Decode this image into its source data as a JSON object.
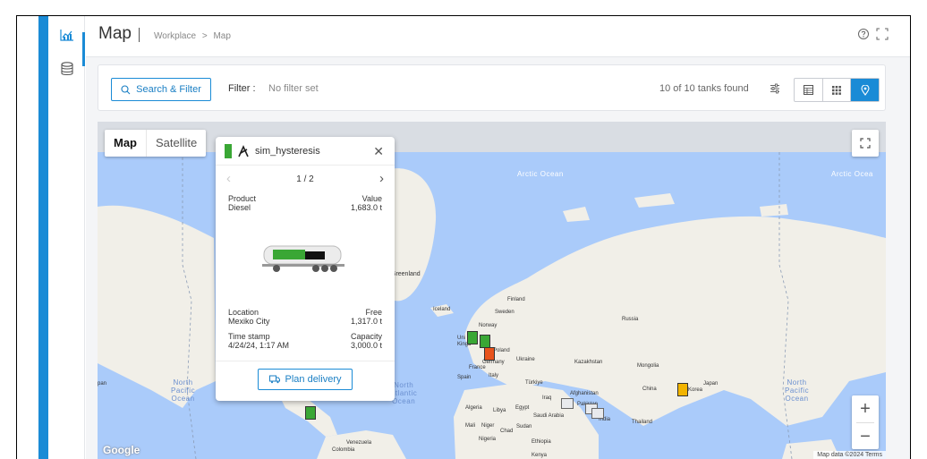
{
  "header": {
    "title": "Map",
    "breadcrumb": [
      "Workplace",
      ">",
      "Map"
    ]
  },
  "sidebar": {
    "items": [
      {
        "icon": "chart-icon",
        "active": true
      },
      {
        "icon": "database-icon",
        "active": false
      }
    ]
  },
  "toolbar": {
    "search_label": "Search & Filter",
    "filter_label": "Filter :",
    "filter_value": "No filter set",
    "found_text": "10 of 10 tanks found"
  },
  "map": {
    "type_map": "Map",
    "type_satellite": "Satellite",
    "google": "Google",
    "attribution": "Map data ©2024   Terms",
    "labels": {
      "arctic1": "Arctic Ocean",
      "arctic2": "Arctic Ocea",
      "greenland": "Greenland",
      "iceland": "Iceland",
      "finland": "Finland",
      "sweden": "Sweden",
      "norway": "Norway",
      "russia": "Russia",
      "uk": "Uni\nKingd",
      "poland": "Poland",
      "ukraine": "Ukraine",
      "france": "France",
      "spain": "Spain",
      "italy": "Italy",
      "germany": "Germany",
      "kazakhstan": "Kazakhstan",
      "mongolia": "Mongolia",
      "china": "China",
      "japan": "Japan",
      "korea": "Korea",
      "turkiye": "Türkiye",
      "afghanistan": "Afghanistan",
      "iraq": "Iraq",
      "pakistan": "Pakistan",
      "saudi": "Saudi Arabia",
      "algeria": "Algeria",
      "libya": "Libya",
      "egypt": "Egypt",
      "india": "India",
      "thailand": "Thailand",
      "mali": "Mali",
      "niger": "Niger",
      "chad": "Chad",
      "sudan": "Sudan",
      "nigeria": "Nigeria",
      "ethiopia": "Ethiopia",
      "kenya": "Kenya",
      "venezuela": "Venezuela",
      "colombia": "Colombia",
      "pan": "pan",
      "north_pacific1": "North\nPacific\nOcean",
      "north_atlantic": "North\nAtlantic\nOcean",
      "north_pacific2": "North\nPacific\nOcean"
    },
    "markers": [
      {
        "color": "#3aa735"
      },
      {
        "color": "#3aa735"
      },
      {
        "color": "#e8531c"
      },
      {
        "color": "#f2b400"
      },
      {
        "color": "#3aa735"
      },
      {
        "color": "#9aa0a6"
      },
      {
        "color": "#9aa0a6"
      },
      {
        "color": "#9aa0a6"
      }
    ]
  },
  "popup": {
    "tank_name": "sim_hysteresis",
    "page": "1 / 2",
    "product_label": "Product",
    "product_value": "Diesel",
    "value_label": "Value",
    "value_value": "1,683.0 t",
    "location_label": "Location",
    "location_value": "Mexiko City",
    "free_label": "Free",
    "free_value": "1,317.0 t",
    "timestamp_label": "Time stamp",
    "timestamp_value": "4/24/24, 1:17 AM",
    "capacity_label": "Capacity",
    "capacity_value": "3,000.0 t",
    "fill_fraction": 0.56,
    "plan_label": "Plan delivery"
  },
  "colors": {
    "accent": "#1a8bd6",
    "tank_green": "#3aa735",
    "tank_orange": "#e8531c",
    "tank_yellow": "#f2b400",
    "ocean": "#aacbfa",
    "land": "#f1efe8"
  }
}
